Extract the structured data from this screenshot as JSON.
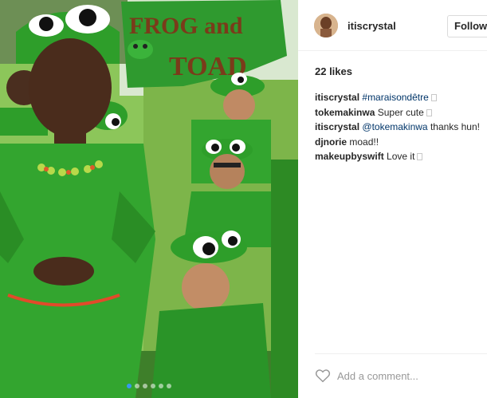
{
  "photo": {
    "banner_line1": "FROG and",
    "banner_line2": "TOAD",
    "carousel_count": 6,
    "carousel_active": 1
  },
  "header": {
    "username": "itiscrystal",
    "follow_label": "Following"
  },
  "post": {
    "likes": "22 likes",
    "comments": [
      {
        "user": "itiscrystal",
        "text": "#maraisondêtre",
        "is_link": true,
        "emoji": true
      },
      {
        "user": "tokemakinwa",
        "text": "Super cute",
        "is_link": false,
        "emoji": true
      },
      {
        "user": "itiscrystal",
        "mention": "@tokemakinwa",
        "text": " thanks hun!",
        "is_link": false,
        "emoji": false
      },
      {
        "user": "djnorie",
        "text": "moad!!",
        "is_link": false,
        "emoji": false
      },
      {
        "user": "makeupbyswift",
        "text": "Love it",
        "is_link": false,
        "emoji": true
      }
    ],
    "add_comment_placeholder": "Add a comment..."
  },
  "colors": {
    "link": "#003569",
    "carousel_active": "#3897f0",
    "costume_green": "#2e9e2a",
    "banner_green": "#2f9a2f"
  },
  "icons": [
    "heart-icon"
  ]
}
